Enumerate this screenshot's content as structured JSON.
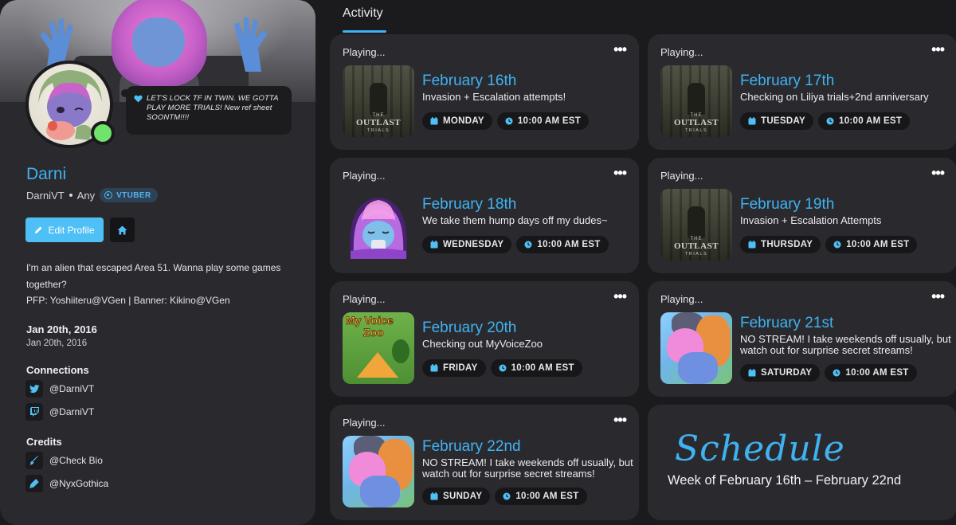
{
  "profile": {
    "status_text": "LET'S LOCK TF IN TWIN. WE GOTTA PLAY MORE TRIALS! New ref sheet SOONTM!!!!",
    "name": "Darni",
    "handle": "DarniVT",
    "pronouns": "Any",
    "badge": "VTUBER",
    "edit_label": "Edit Profile",
    "bio_lines": [
      "I'm an alien that escaped Area 51. Wanna play some games",
      "together?",
      "PFP: Yoshiiteru@VGen | Banner: Kikino@VGen"
    ],
    "date_heading": "Jan 20th, 2016",
    "date_sub": "Jan 20th, 2016",
    "connections_title": "Connections",
    "connections": [
      {
        "icon": "twitter-icon",
        "label": "@DarniVT"
      },
      {
        "icon": "twitch-icon",
        "label": "@DarniVT"
      }
    ],
    "credits_title": "Credits",
    "credits": [
      {
        "icon": "brush-icon",
        "label": "@Check Bio"
      },
      {
        "icon": "pen-icon",
        "label": "@NyxGothica"
      }
    ],
    "colors": {
      "accent": "#3fb2f2",
      "online": "#6fe36a"
    }
  },
  "activity": {
    "tab_label": "Activity",
    "playing_label": "Playing...",
    "more_label": "•••",
    "cards": [
      {
        "date": "February 16th",
        "desc": "Invasion + Escalation attempts!",
        "day": "MONDAY",
        "time": "10:00 AM EST",
        "thumb": "outlast-trials"
      },
      {
        "date": "February 17th",
        "desc": "Checking on Liliya trials+2nd anniversary",
        "day": "TUESDAY",
        "time": "10:00 AM EST",
        "thumb": "outlast-trials"
      },
      {
        "date": "February 18th",
        "desc": "We take them hump days off my dudes~",
        "day": "WEDNESDAY",
        "time": "10:00 AM EST",
        "thumb": "sleepy-hoodie"
      },
      {
        "date": "February 19th",
        "desc": "Invasion + Escalation Attempts",
        "day": "THURSDAY",
        "time": "10:00 AM EST",
        "thumb": "outlast-trials"
      },
      {
        "date": "February 20th",
        "desc": "Checking out MyVoiceZoo",
        "day": "FRIDAY",
        "time": "10:00 AM EST",
        "thumb": "my-voice-zoo"
      },
      {
        "date": "February 21st",
        "desc": "NO STREAM! I take weekends off usually, but watch out for surprise secret streams!",
        "day": "SATURDAY",
        "time": "10:00 AM EST",
        "thumb": "pony-art"
      },
      {
        "date": "February 22nd",
        "desc": "NO STREAM! I take weekends off usually, but watch out for surprise secret streams!",
        "day": "SUNDAY",
        "time": "10:00 AM EST",
        "thumb": "pony-art"
      }
    ],
    "outlast_text": {
      "top": "THE",
      "main": "OUTLAST",
      "bottom": "TRIALS"
    },
    "mvz_text": {
      "line1": "My Voice",
      "line2": "Zoo"
    },
    "schedule": {
      "title": "Schedule",
      "week": "Week of February 16th – February 22nd"
    }
  }
}
